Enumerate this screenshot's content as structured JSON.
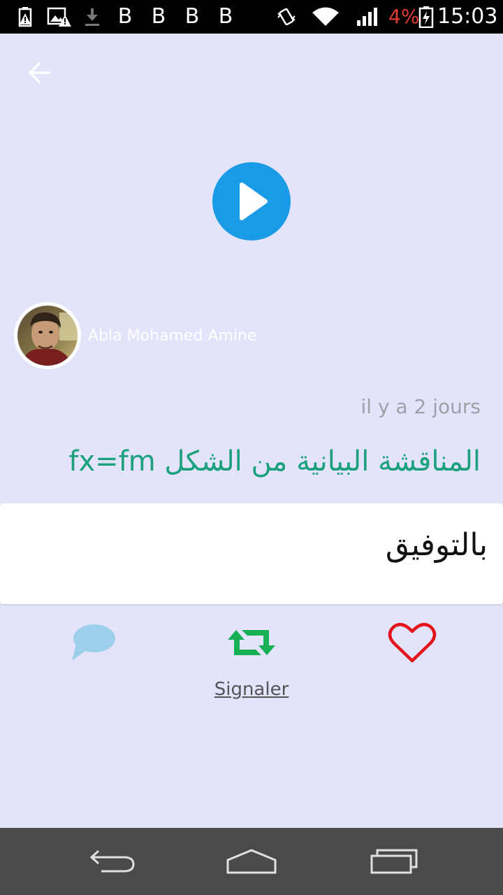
{
  "status_bar": {
    "b_icons": [
      "B",
      "B",
      "B",
      "B"
    ],
    "battery_percent": "4%",
    "time": "15:03",
    "battery_color": "#e53935"
  },
  "post": {
    "author": "Abla Mohamed Amine",
    "time_ago": "il y a 2 jours",
    "title": "المناقشة البيانية من الشكل fx=fm",
    "comment": "بالتوفيق",
    "report_label": "Signaler"
  },
  "colors": {
    "background": "#e3e3fb",
    "play": "#1a9be6",
    "title": "#1ba17c",
    "comment_icon": "#9cd0ea",
    "repost_icon": "#17b055",
    "heart_icon": "#e3141c"
  },
  "icons": {
    "back": "arrow-left-icon",
    "play": "play-icon",
    "comment": "comment-bubble-icon",
    "repost": "repost-icon",
    "like": "heart-icon",
    "nav_back": "nav-back-icon",
    "nav_home": "nav-home-icon",
    "nav_recents": "nav-recents-icon"
  }
}
